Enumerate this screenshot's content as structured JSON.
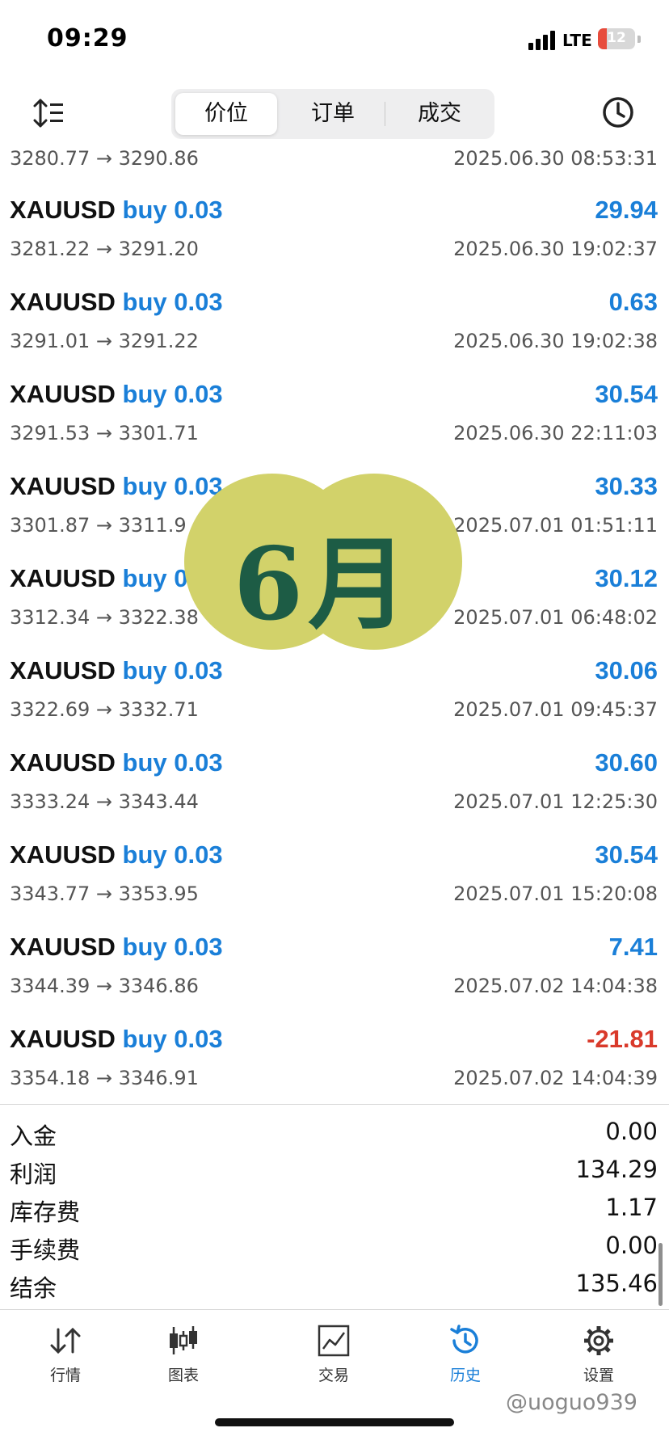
{
  "status_bar": {
    "time": "09:29",
    "network": "LTE",
    "battery": "12"
  },
  "tabs": [
    "价位",
    "订单",
    "成交"
  ],
  "active_tab": 0,
  "partial_row": {
    "prices": "3280.77 → 3290.86",
    "datetime": "2025.06.30 08:53:31"
  },
  "deals": [
    {
      "symbol": "XAUUSD",
      "side": "buy 0.03",
      "profit": "29.94",
      "prices": "3281.22 → 3291.20",
      "datetime": "2025.06.30 19:02:37"
    },
    {
      "symbol": "XAUUSD",
      "side": "buy 0.03",
      "profit": "0.63",
      "prices": "3291.01 → 3291.22",
      "datetime": "2025.06.30 19:02:38"
    },
    {
      "symbol": "XAUUSD",
      "side": "buy 0.03",
      "profit": "30.54",
      "prices": "3291.53 → 3301.71",
      "datetime": "2025.06.30 22:11:03"
    },
    {
      "symbol": "XAUUSD",
      "side": "buy 0.03",
      "profit": "30.33",
      "prices": "3301.87 → 3311.9",
      "datetime": "2025.07.01 01:51:11"
    },
    {
      "symbol": "XAUUSD",
      "side": "buy 0.03",
      "profit": "30.12",
      "prices": "3312.34 → 3322.38",
      "datetime": "2025.07.01 06:48:02"
    },
    {
      "symbol": "XAUUSD",
      "side": "buy 0.03",
      "profit": "30.06",
      "prices": "3322.69 → 3332.71",
      "datetime": "2025.07.01 09:45:37"
    },
    {
      "symbol": "XAUUSD",
      "side": "buy 0.03",
      "profit": "30.60",
      "prices": "3333.24 → 3343.44",
      "datetime": "2025.07.01 12:25:30"
    },
    {
      "symbol": "XAUUSD",
      "side": "buy 0.03",
      "profit": "30.54",
      "prices": "3343.77 → 3353.95",
      "datetime": "2025.07.01 15:20:08"
    },
    {
      "symbol": "XAUUSD",
      "side": "buy 0.03",
      "profit": "7.41",
      "prices": "3344.39 → 3346.86",
      "datetime": "2025.07.02 14:04:38"
    },
    {
      "symbol": "XAUUSD",
      "side": "buy 0.03",
      "profit": "-21.81",
      "prices": "3354.18 → 3346.91",
      "datetime": "2025.07.02 14:04:39"
    }
  ],
  "summary": [
    {
      "label": "入金",
      "value": "0.00"
    },
    {
      "label": "利润",
      "value": "134.29"
    },
    {
      "label": "库存费",
      "value": "1.17"
    },
    {
      "label": "手续费",
      "value": "0.00"
    },
    {
      "label": "结余",
      "value": "135.46"
    }
  ],
  "bottom_tabs": [
    {
      "label": "行情",
      "icon": "quotes-arrows-icon"
    },
    {
      "label": "图表",
      "icon": "candlestick-chart-icon"
    },
    {
      "label": "交易",
      "icon": "trade-chart-icon"
    },
    {
      "label": "历史",
      "icon": "history-icon"
    },
    {
      "label": "设置",
      "icon": "settings-gear-icon"
    }
  ],
  "active_bottom_tab": 3,
  "overlay": {
    "text": "6月"
  },
  "watermark": "@uoguo939",
  "colors": {
    "accent": "#1a7fd8",
    "negative": "#d93a2b",
    "badge_bg": "#d2d26a",
    "badge_text": "#1d5c45"
  }
}
